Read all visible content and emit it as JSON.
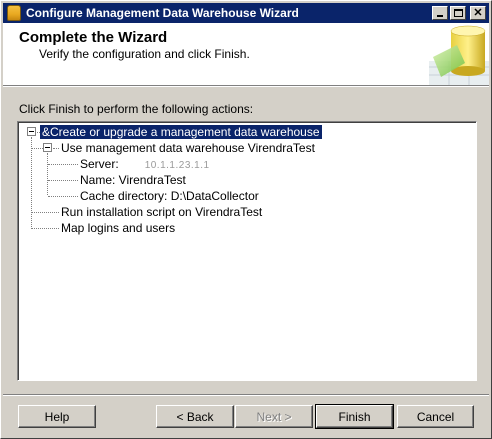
{
  "window": {
    "title": "Configure Management Data Warehouse Wizard",
    "app_icon": "database-icon"
  },
  "header": {
    "title": "Complete the Wizard",
    "subtitle": "Verify the configuration and click Finish."
  },
  "instruction": "Click Finish to perform the following actions:",
  "tree": {
    "root": "&Create or upgrade a management data warehouse",
    "use_node": "Use management data warehouse VirendraTest",
    "server_label": "Server:",
    "server_value": "10.1.1.23.1.1",
    "name_label": "Name: VirendraTest",
    "cache_label": "Cache directory: D:\\DataCollector",
    "run_node": "Run installation script on VirendraTest",
    "map_node": "Map logins and users"
  },
  "buttons": {
    "help": "Help",
    "back": "< Back",
    "next": "Next >",
    "finish": "Finish",
    "cancel": "Cancel"
  },
  "colors": {
    "titlebar": "#0a246a",
    "face": "#d4d0c8",
    "selection": "#0a246a"
  }
}
